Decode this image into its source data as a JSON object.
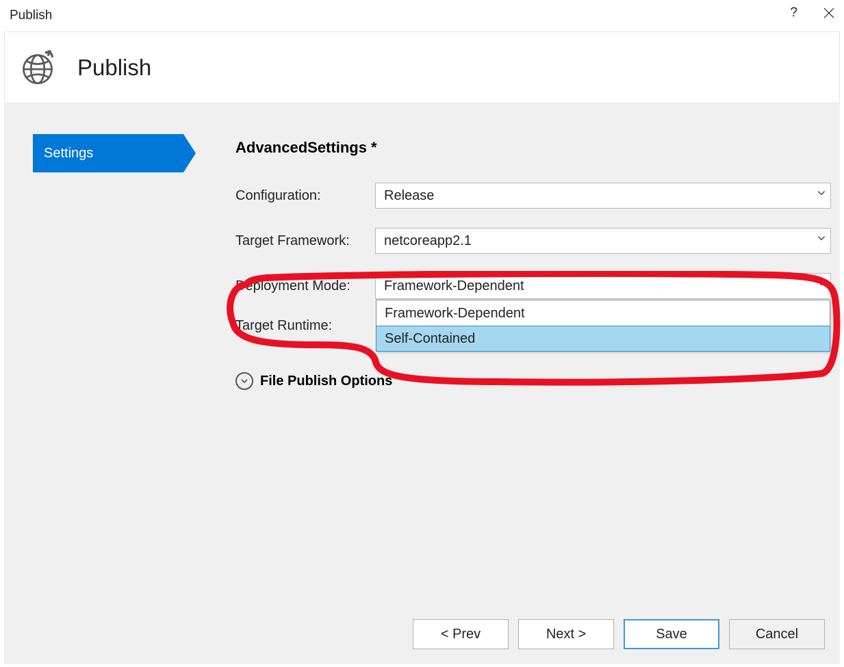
{
  "window": {
    "title": "Publish"
  },
  "header": {
    "title": "Publish"
  },
  "nav": {
    "active_tab": "Settings"
  },
  "section": {
    "title": "AdvancedSettings *"
  },
  "form": {
    "configuration": {
      "label": "Configuration:",
      "value": "Release"
    },
    "target_framework": {
      "label": "Target Framework:",
      "value": "netcoreapp2.1"
    },
    "deployment_mode": {
      "label": "Deployment Mode:",
      "value": "Framework-Dependent",
      "options": [
        "Framework-Dependent",
        "Self-Contained"
      ],
      "highlighted_option_index": 1
    },
    "target_runtime": {
      "label": "Target Runtime:"
    },
    "expander": {
      "label": "File Publish Options"
    }
  },
  "buttons": {
    "prev": "< Prev",
    "next": "Next >",
    "save": "Save",
    "cancel": "Cancel"
  }
}
